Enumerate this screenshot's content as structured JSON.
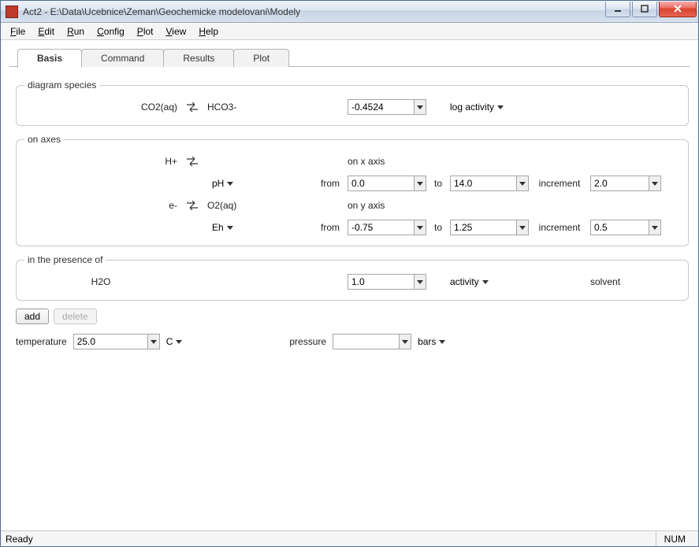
{
  "window": {
    "title": "Act2 - E:\\Data\\Ucebnice\\Zeman\\Geochemicke modelovani\\Modely"
  },
  "menu": {
    "file": "File",
    "edit": "Edit",
    "run": "Run",
    "config": "Config",
    "plot": "Plot",
    "view": "View",
    "help": "Help"
  },
  "tabs": {
    "basis": "Basis",
    "command": "Command",
    "results": "Results",
    "plot": "Plot"
  },
  "groups": {
    "diagram_species": "diagram species",
    "on_axes": "on axes",
    "presence": "in the presence of"
  },
  "diagram": {
    "species": "CO2(aq)",
    "swap_to": "HCO3-",
    "value": "-0.4524",
    "basis": "log activity"
  },
  "x_axis": {
    "species": "H+",
    "axis_label": "on x axis",
    "unit": "pH",
    "from_label": "from",
    "from": "0.0",
    "to_label": "to",
    "to": "14.0",
    "inc_label": "increment",
    "inc": "2.0"
  },
  "y_axis": {
    "species": "e-",
    "swap_to": "O2(aq)",
    "axis_label": "on y axis",
    "unit": "Eh",
    "from_label": "from",
    "from": "-0.75",
    "to_label": "to",
    "to": "1.25",
    "inc_label": "increment",
    "inc": "0.5"
  },
  "presence": {
    "species": "H2O",
    "value": "1.0",
    "basis": "activity",
    "role": "solvent"
  },
  "buttons": {
    "add": "add",
    "delete": "delete"
  },
  "temperature": {
    "label": "temperature",
    "value": "25.0",
    "unit": "C"
  },
  "pressure": {
    "label": "pressure",
    "value": "",
    "unit": "bars"
  },
  "status": {
    "ready": "Ready",
    "num": "NUM"
  }
}
